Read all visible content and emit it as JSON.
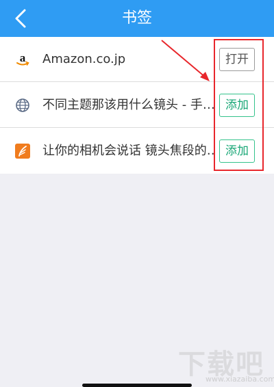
{
  "header": {
    "title": "书签"
  },
  "bookmarks": [
    {
      "title": "Amazon.co.jp",
      "icon": "amazon-icon",
      "action": "打开"
    },
    {
      "title": "不同主题那该用什么镜头 - 手…",
      "icon": "globe-icon",
      "action": "添加"
    },
    {
      "title": "让你的相机会说话 镜头焦段的…",
      "icon": "feather-icon",
      "action": "添加"
    }
  ],
  "watermark": {
    "text": "下载吧",
    "url": "www.xiazaiba.com"
  },
  "colors": {
    "header": "#2f9cf3",
    "add_button": "#1aa777",
    "annotation": "#e8262b"
  }
}
